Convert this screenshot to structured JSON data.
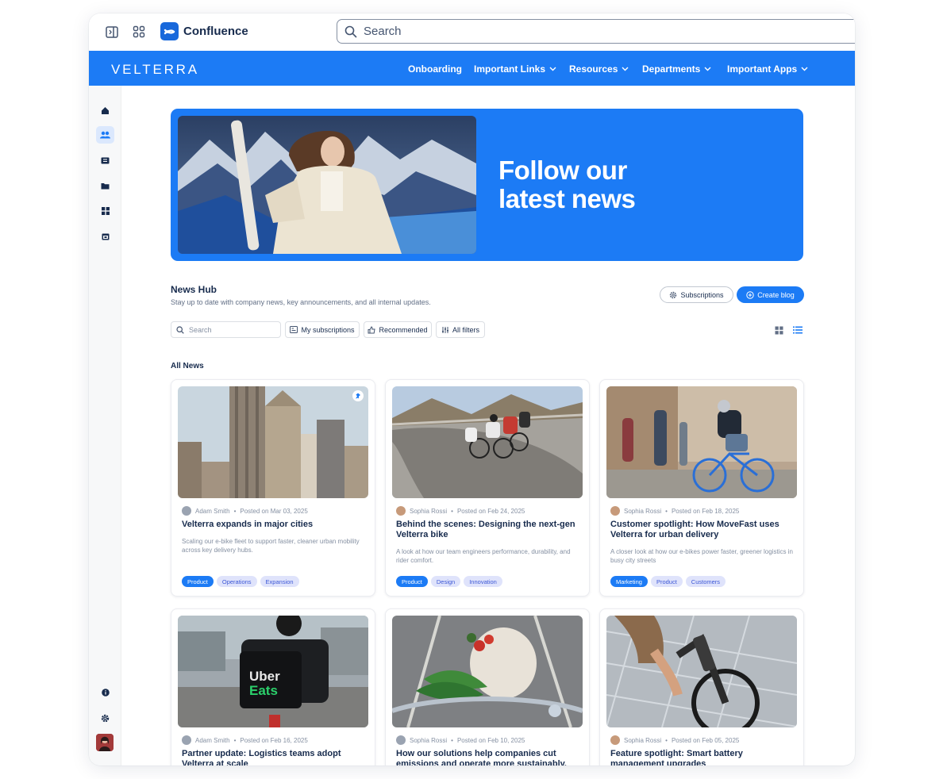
{
  "app": {
    "name": "Confluence",
    "search_placeholder": "Search"
  },
  "nav": {
    "brand": "VELTERRA",
    "items": [
      {
        "label": "Onboarding",
        "dropdown": false
      },
      {
        "label": "Important Links",
        "dropdown": true
      },
      {
        "label": "Resources",
        "dropdown": true
      },
      {
        "label": "Departments",
        "dropdown": true
      },
      {
        "label": "Important Apps",
        "dropdown": true
      }
    ]
  },
  "rail": {
    "icons": [
      "home-icon",
      "people-icon",
      "feed-icon",
      "folder-icon",
      "apps-icon",
      "calendar-icon"
    ],
    "bottom_icons": [
      "info-icon",
      "settings-icon"
    ],
    "active": "people-icon"
  },
  "hero": {
    "title_line1": "Follow our",
    "title_line2": "latest news"
  },
  "hub": {
    "title": "News Hub",
    "subtitle": "Stay up to date with company news, key announcements, and all internal updates.",
    "subscriptions_label": "Subscriptions",
    "create_label": "Create blog",
    "search_placeholder": "Search",
    "filters": [
      "My subscriptions",
      "Recommended",
      "All filters"
    ],
    "section_title": "All News"
  },
  "colors": {
    "accent": "#1c7bf5",
    "tag_bg": "#dfe3fb",
    "tag_text": "#3d58d6"
  },
  "cards": [
    {
      "author": "Adam Smith",
      "posted": "Posted on Mar 03, 2025",
      "title": "Velterra expands in major cities",
      "desc": "Scaling our e-bike fleet to support faster, cleaner urban mobility across key delivery hubs.",
      "tags": [
        "Product",
        "Operations",
        "Expansion"
      ],
      "pinned": true
    },
    {
      "author": "Sophia Rossi",
      "posted": "Posted on Feb 24, 2025",
      "title": "Behind the scenes: Designing the next-gen Velterra bike",
      "desc": "A look at how our team engineers performance, durability, and rider comfort.",
      "tags": [
        "Product",
        "Design",
        "Innovation"
      ],
      "pinned": false
    },
    {
      "author": "Sophia Rossi",
      "posted": "Posted on Feb 18, 2025",
      "title": "Customer spotlight: How MoveFast uses Velterra for urban delivery",
      "desc": "A closer look at how our e-bikes power faster, greener logistics in busy city streets",
      "tags": [
        "Marketing",
        "Product",
        "Customers"
      ],
      "pinned": false
    },
    {
      "author": "Adam Smith",
      "posted": "Posted on Feb 16, 2025",
      "title": "Partner update: Logistics teams adopt Velterra at scale",
      "desc": "",
      "tags": [],
      "pinned": false
    },
    {
      "author": "Sophia Rossi",
      "posted": "Posted on Feb 10, 2025",
      "title": "How our solutions help companies cut emissions and operate more sustainably.",
      "desc": "",
      "tags": [],
      "pinned": false
    },
    {
      "author": "Sophia Rossi",
      "posted": "Posted on Feb 05, 2025",
      "title": "Feature spotlight: Smart battery management upgrades",
      "desc": "",
      "tags": [],
      "pinned": false
    }
  ]
}
